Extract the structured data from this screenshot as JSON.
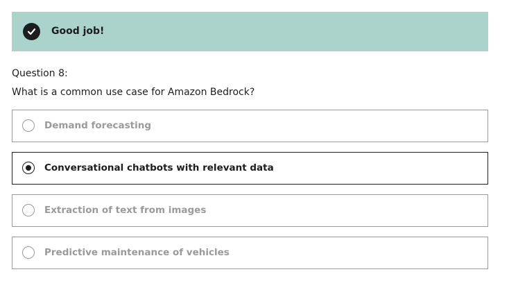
{
  "feedback": {
    "icon": "checkmark-icon",
    "text": "Good job!",
    "color": "#acd2cc"
  },
  "question": {
    "number": "Question 8:",
    "prompt": "What is a common use case for Amazon Bedrock?"
  },
  "options": [
    {
      "label": "Demand forecasting",
      "selected": false
    },
    {
      "label": "Conversational chatbots with relevant data",
      "selected": true
    },
    {
      "label": "Extraction of text from images",
      "selected": false
    },
    {
      "label": "Predictive maintenance of vehicles",
      "selected": false
    }
  ]
}
